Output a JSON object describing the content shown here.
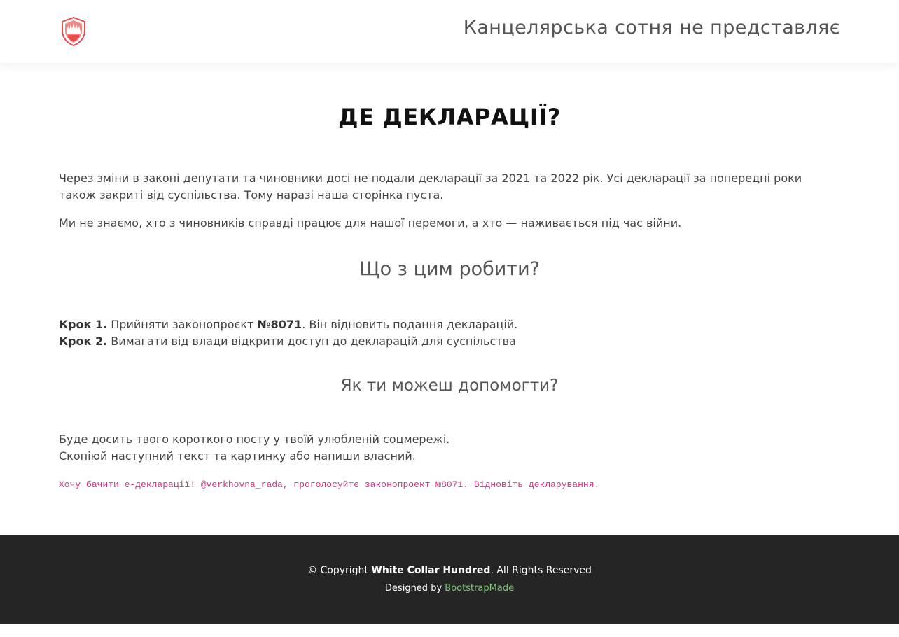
{
  "header": {
    "logo_icon": "shield-flame-logo-icon",
    "tagline": "Канцелярська сотня не представляє"
  },
  "main": {
    "title": "ДЕ ДЕКЛАРАЦІЇ?",
    "intro": "Через зміни в законі депутати та чиновники досі не подали декларації за 2021 та 2022 рік. Усі декларації за попередні роки також закриті від суспільства. Тому наразі наша сторінка пуста.",
    "second": "Ми не знаємо, хто з чиновників справді працює для нашої перемоги, а хто — наживається під час війни.",
    "what_title": "Що з цим робити?",
    "steps": [
      {
        "label": "Крок 1.",
        "before": " Прийняти законопроєкт ",
        "bill": "№8071",
        "after": ". Він відновить подання декларацій."
      },
      {
        "label": "Крок 2.",
        "before": " Вимагати від влади відкрити доступ до декларацій для суспільства",
        "bill": "",
        "after": ""
      }
    ],
    "help_title": "Як ти можеш допомогти?",
    "help_lines": [
      "Буде досить твого короткого посту у твоїй улюбленій соцмережі.",
      "Скопіюй наступний текст та картинку або напиши власний."
    ],
    "share_text": "Хочу бачити е-декларації! @verkhovna_rada, проголосуйте законопроект №8071. Відновіть декларування."
  },
  "footer": {
    "copyright_prefix": "© Copyright ",
    "org": "White Collar Hundred",
    "copyright_suffix": ". All Rights Reserved",
    "designed_by": "Designed by ",
    "designer_link": "BootstrapMade"
  },
  "colors": {
    "accent_link": "#7cc576",
    "code": "#d63384",
    "footer_bg": "#252525",
    "logo_red": "#e84c4c"
  }
}
